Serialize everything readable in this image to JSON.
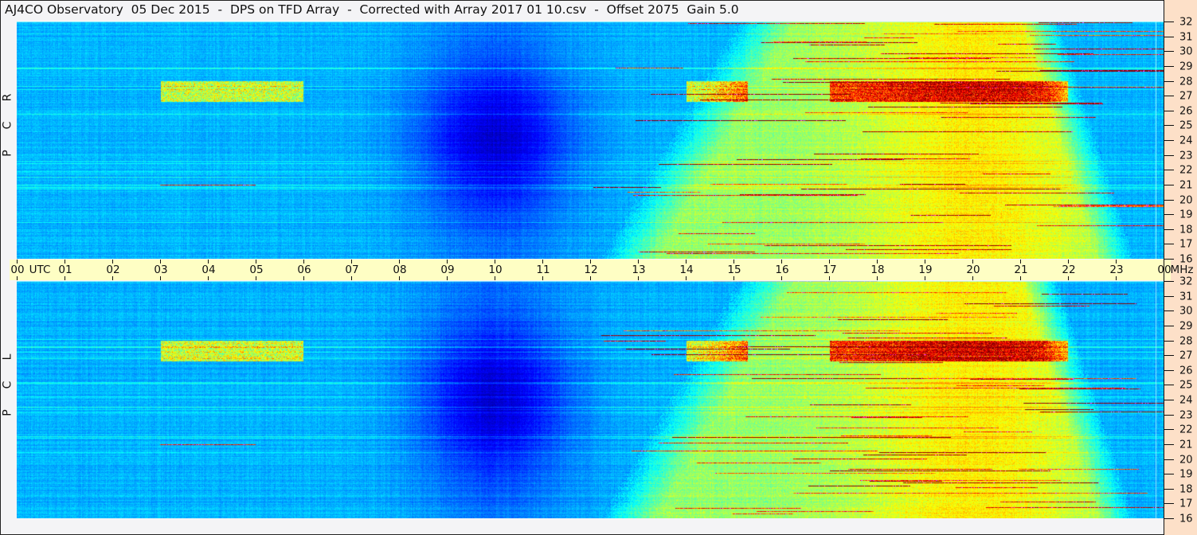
{
  "title": "AJ4CO Observatory  05 Dec 2015  -  DPS on TFD Array  -  Corrected with Array 2017 01 10.csv  -  Offset 2075  Gain 5.0",
  "chart_data": {
    "type": "heatmap",
    "panels": [
      {
        "name": "R C P",
        "letters": [
          "R",
          "C",
          "P"
        ]
      },
      {
        "name": "L C P",
        "letters": [
          "L",
          "C",
          "P"
        ]
      }
    ],
    "x_axis": {
      "unit": "UTC",
      "range": [
        0,
        24
      ],
      "tick_labels": [
        "00",
        "01",
        "02",
        "03",
        "04",
        "05",
        "06",
        "07",
        "08",
        "09",
        "10",
        "11",
        "12",
        "13",
        "14",
        "15",
        "16",
        "17",
        "18",
        "19",
        "20",
        "21",
        "22",
        "23",
        "00"
      ]
    },
    "y_axis": {
      "unit": "MHz",
      "range": [
        16,
        32
      ],
      "tick_labels": [
        "32",
        "31",
        "30",
        "29",
        "28",
        "27",
        "26",
        "25",
        "24",
        "23",
        "22",
        "21",
        "20",
        "19",
        "18",
        "17",
        "16"
      ]
    },
    "colormap": "jet",
    "colors": {
      "background_low": "#0a1a6a",
      "background": "#1a5ce0",
      "strip": "#fefec4",
      "axis_panel": "#fde0c8"
    }
  }
}
